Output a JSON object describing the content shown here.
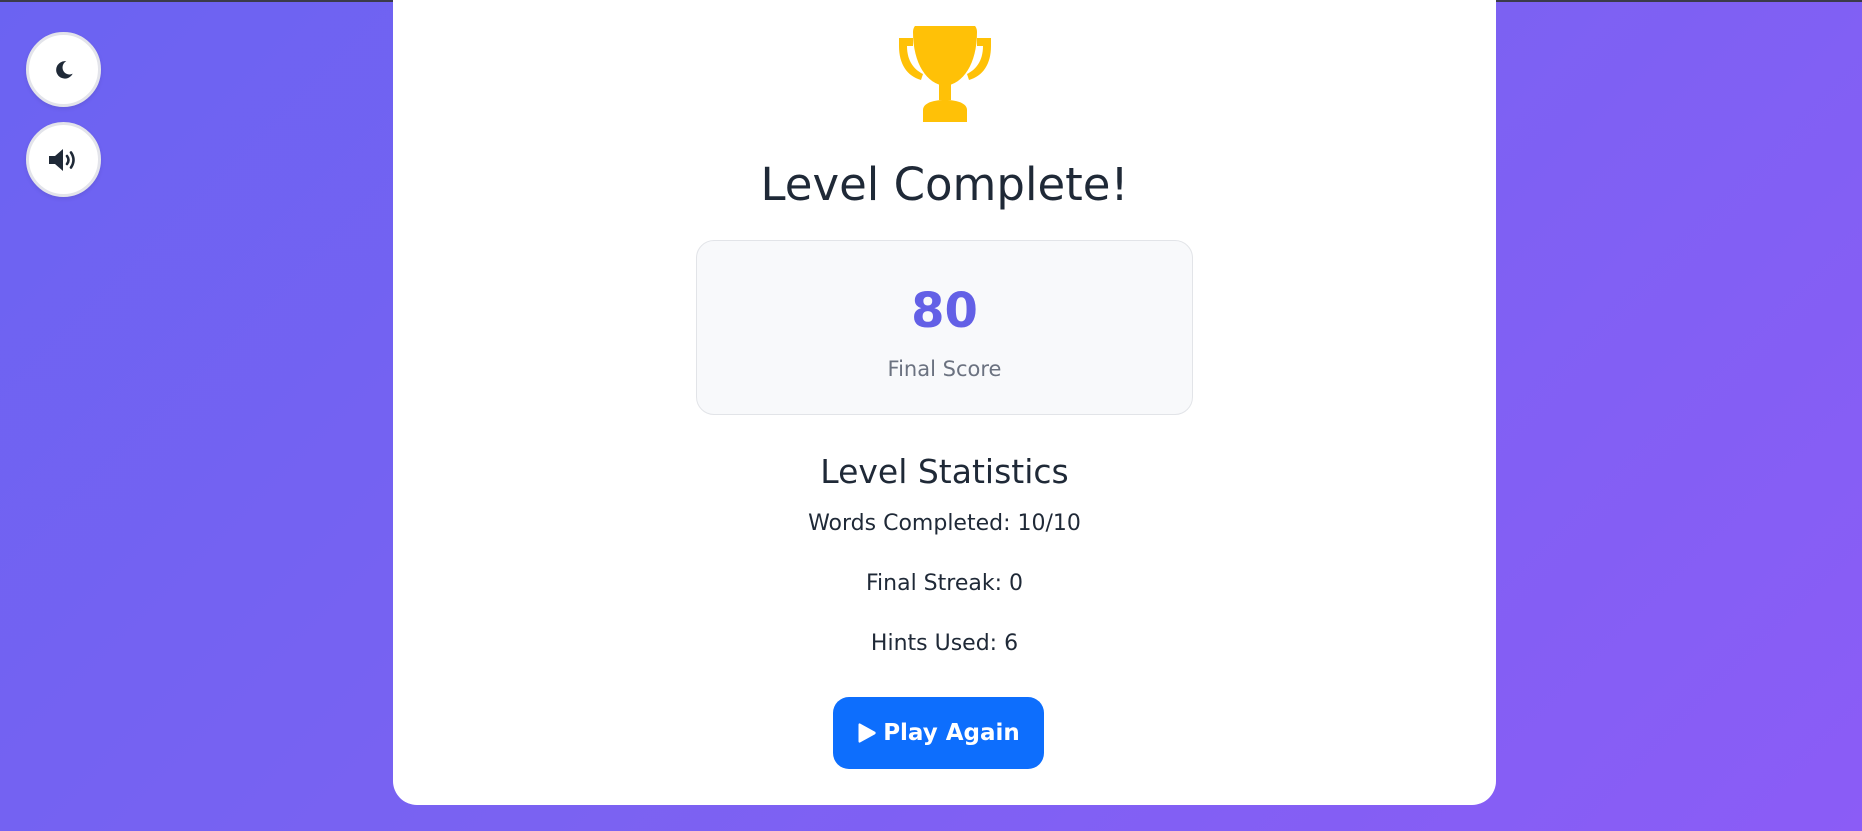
{
  "controls": {
    "theme_icon": "moon-icon",
    "sound_icon": "volume-high-icon"
  },
  "result": {
    "title": "Level Complete!",
    "trophy_icon": "trophy-icon",
    "trophy_color": "#FFC107",
    "score_value": "80",
    "score_label": "Final Score"
  },
  "statistics": {
    "title": "Level Statistics",
    "words_completed": "Words Completed: 10/10",
    "final_streak": "Final Streak: 0",
    "hints_used": "Hints Used: 6"
  },
  "actions": {
    "play_again_label": "Play Again",
    "play_icon": "play-icon",
    "button_color": "#0D6EFD"
  },
  "colors": {
    "background_start": "#6B63F2",
    "background_end": "#8B5CF6",
    "score_accent": "#6360E6"
  }
}
